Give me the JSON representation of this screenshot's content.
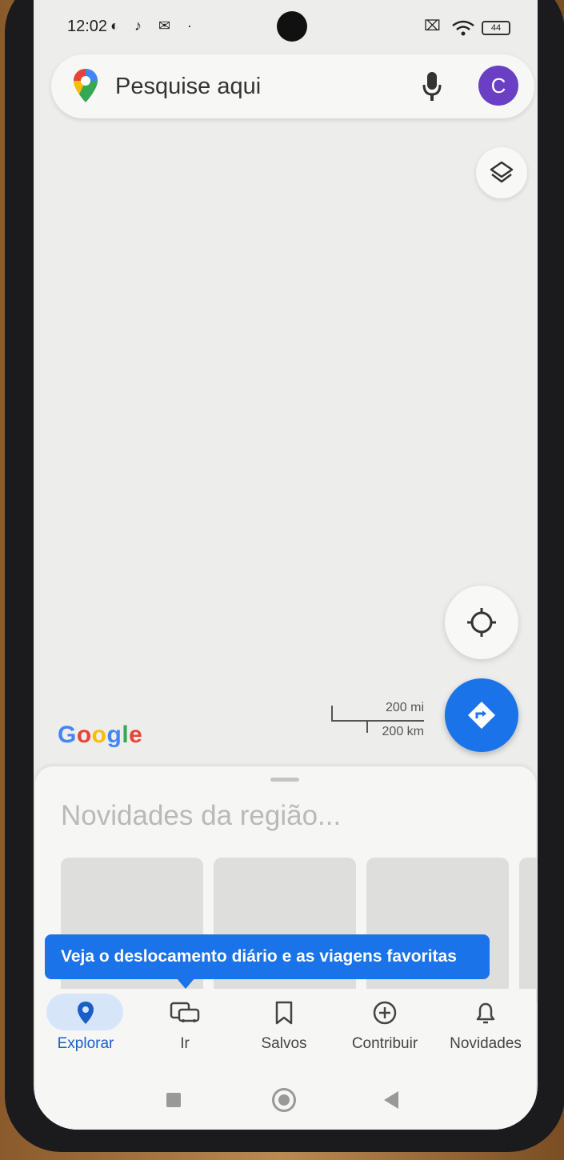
{
  "status_bar": {
    "time": "12:02",
    "notification_icons": [
      "data-saver-icon",
      "tiktok-icon",
      "gmail-icon",
      "dot-icon"
    ],
    "battery": "44"
  },
  "search": {
    "placeholder": "Pesquise aqui",
    "avatar_letter": "C"
  },
  "map": {
    "scale_top": "200 mi",
    "scale_bottom": "200 km",
    "logo": "Google"
  },
  "sheet": {
    "title": "Novidades da região..."
  },
  "tooltip": {
    "text": "Veja o deslocamento diário e as viagens favoritas"
  },
  "nav": {
    "items": [
      {
        "label": "Explorar",
        "icon": "pin-icon",
        "active": true
      },
      {
        "label": "Ir",
        "icon": "commute-icon",
        "active": false
      },
      {
        "label": "Salvos",
        "icon": "bookmark-icon",
        "active": false
      },
      {
        "label": "Contribuir",
        "icon": "add-circle-icon",
        "active": false
      },
      {
        "label": "Novidades",
        "icon": "bell-icon",
        "active": false
      }
    ]
  },
  "colors": {
    "accent": "#1a73e8",
    "avatar": "#6b3fc4",
    "active_pill": "#d7e5f8"
  }
}
